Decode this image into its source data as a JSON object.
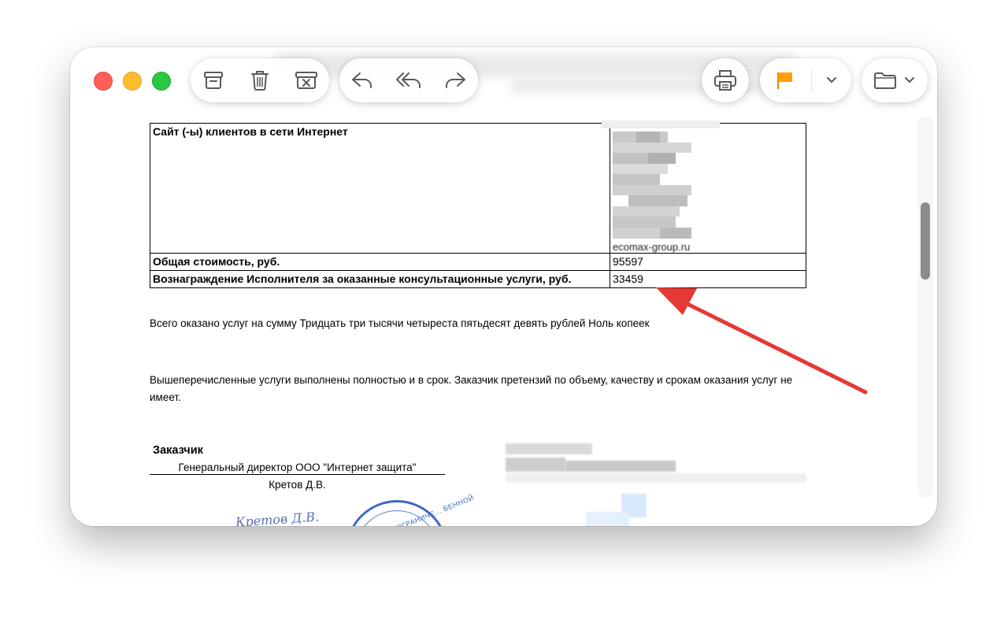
{
  "window": {
    "buttons": {
      "archive": "archive-icon",
      "delete": "trash-icon",
      "junk": "junk-icon",
      "reply": "reply-icon",
      "reply_all": "reply-all-icon",
      "forward": "forward-icon",
      "print": "printer-icon",
      "flag": "flag-icon",
      "flag_menu": "chevron-down-icon",
      "move": "folder-icon",
      "move_menu": "chevron-down-icon"
    },
    "colors": {
      "flag": "#ff9f0a",
      "close": "#ff5f57",
      "minimize": "#febc2e",
      "zoom": "#28c840",
      "annotation_arrow": "#e53935"
    }
  },
  "document": {
    "table": {
      "rows": [
        {
          "label": "Сайт (-ы) клиентов в сети Интернет",
          "value": "ecomax-group.ru"
        },
        {
          "label": "Общая стоимость, руб.",
          "value": "95597"
        },
        {
          "label": "Вознаграждение Исполнителя за оказанные консультационные услуги, руб.",
          "value": "33459"
        }
      ]
    },
    "total_text": "Всего оказано услуг на сумму Тридцать три тысячи четыреста пятьдесят девять рублей Ноль копеек",
    "completion_text": "Вышеперечисленные услуги выполнены полностью и в срок. Заказчик претензий по объему, качеству и срокам оказания услуг не имеет.",
    "customer": {
      "label": "Заказчик",
      "position": "Генеральный директор ООО \"Интернет защита\"",
      "name": "Кретов Д.В."
    },
    "signature_text": "Кретов Д.В.",
    "stamp_text": "ВО С ОГРАНИЧЕ... ВЕННОЙ"
  }
}
